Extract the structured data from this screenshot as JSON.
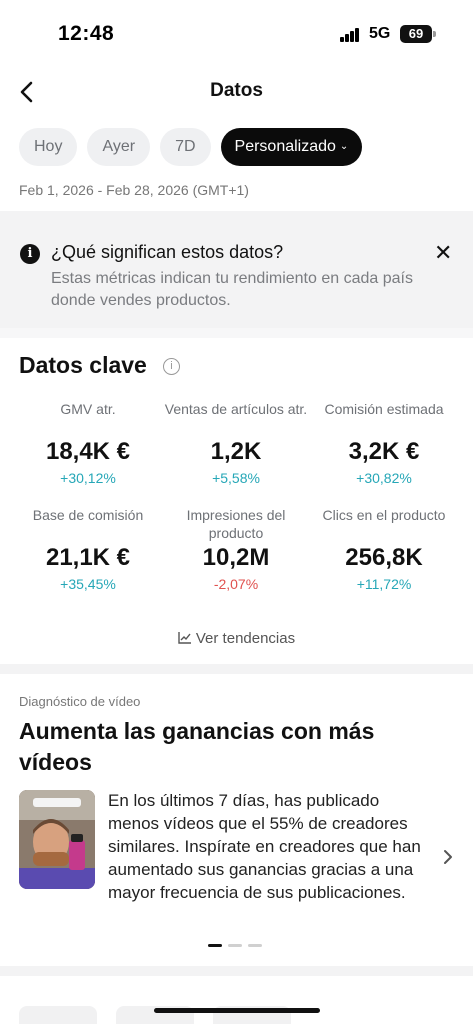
{
  "status_bar": {
    "time": "12:48",
    "network": "5G",
    "battery": "69"
  },
  "header": {
    "title": "Datos"
  },
  "chips": [
    {
      "label": "Hoy"
    },
    {
      "label": "Ayer"
    },
    {
      "label": "7D"
    },
    {
      "label": "Personalizado"
    }
  ],
  "date_range": "Feb 1, 2026 - Feb 28, 2026 (GMT+1)",
  "banner": {
    "title": "¿Qué significan estos datos?",
    "text": "Estas métricas indican tu rendimiento en cada país donde vendes productos."
  },
  "key_data": {
    "title": "Datos clave",
    "metrics": [
      {
        "label": "GMV atr.",
        "value": "18,4K €",
        "change": "+30,12%"
      },
      {
        "label": "Ventas de artículos atr.",
        "value": "1,2K",
        "change": "+5,58%"
      },
      {
        "label": "Comisión estimada",
        "value": "3,2K €",
        "change": "+30,82%"
      },
      {
        "label": "Base de comisión",
        "value": "21,1K €",
        "change": "+35,45%"
      },
      {
        "label": "Impresiones del producto",
        "value": "10,2M",
        "change": "-2,07%"
      },
      {
        "label": "Clics en el producto",
        "value": "256,8K",
        "change": "+11,72%"
      }
    ],
    "trends_label": "Ver tendencias"
  },
  "diagnostic": {
    "label": "Diagnóstico de vídeo",
    "title": "Aumenta las ganancias con más vídeos",
    "text": "En los últimos 7 días, has publicado menos vídeos que el 55% de creadores similares. Inspírate en creadores que han aumentado sus ganancias gracias a una mayor frecuencia de sus publicaciones."
  },
  "colors": {
    "positive": "#26a7b7",
    "negative": "#e0524f",
    "chip_active": "#0b0b0b"
  },
  "icons": [
    "back-icon",
    "info-icon",
    "close-icon",
    "help-icon",
    "trend-chart-icon",
    "chevron-right-icon",
    "chevron-down-icon"
  ]
}
